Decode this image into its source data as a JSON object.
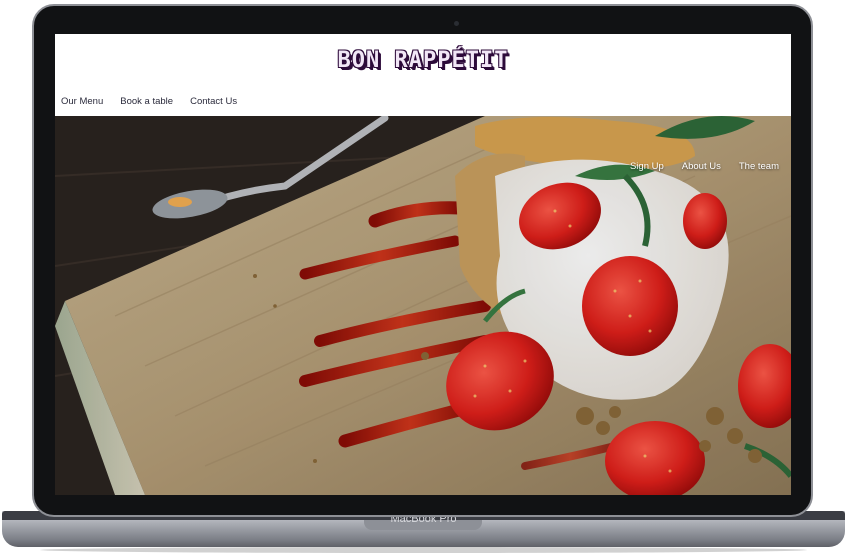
{
  "device": {
    "label": "MacBook Pro"
  },
  "site": {
    "logo": "BON RAPPÉTIT",
    "nav_left": [
      {
        "label": "Our Menu"
      },
      {
        "label": "Book a table"
      },
      {
        "label": "Contact Us"
      }
    ],
    "nav_right": [
      {
        "label": "Sign Up"
      },
      {
        "label": "About Us"
      },
      {
        "label": "The team"
      }
    ]
  },
  "hero": {
    "subject": "strawberry shortcake dessert on wooden board"
  }
}
